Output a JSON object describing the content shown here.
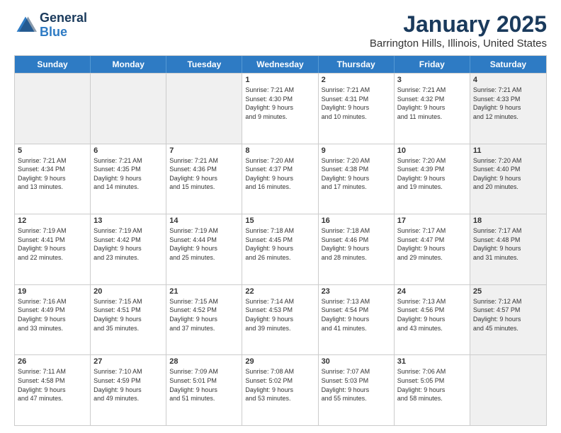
{
  "header": {
    "logo_line1": "General",
    "logo_line2": "Blue",
    "title": "January 2025",
    "subtitle": "Barrington Hills, Illinois, United States"
  },
  "days_of_week": [
    "Sunday",
    "Monday",
    "Tuesday",
    "Wednesday",
    "Thursday",
    "Friday",
    "Saturday"
  ],
  "weeks": [
    [
      {
        "day": "",
        "info": "",
        "shaded": true
      },
      {
        "day": "",
        "info": "",
        "shaded": true
      },
      {
        "day": "",
        "info": "",
        "shaded": true
      },
      {
        "day": "1",
        "info": "Sunrise: 7:21 AM\nSunset: 4:30 PM\nDaylight: 9 hours\nand 9 minutes.",
        "shaded": false
      },
      {
        "day": "2",
        "info": "Sunrise: 7:21 AM\nSunset: 4:31 PM\nDaylight: 9 hours\nand 10 minutes.",
        "shaded": false
      },
      {
        "day": "3",
        "info": "Sunrise: 7:21 AM\nSunset: 4:32 PM\nDaylight: 9 hours\nand 11 minutes.",
        "shaded": false
      },
      {
        "day": "4",
        "info": "Sunrise: 7:21 AM\nSunset: 4:33 PM\nDaylight: 9 hours\nand 12 minutes.",
        "shaded": true
      }
    ],
    [
      {
        "day": "5",
        "info": "Sunrise: 7:21 AM\nSunset: 4:34 PM\nDaylight: 9 hours\nand 13 minutes.",
        "shaded": false
      },
      {
        "day": "6",
        "info": "Sunrise: 7:21 AM\nSunset: 4:35 PM\nDaylight: 9 hours\nand 14 minutes.",
        "shaded": false
      },
      {
        "day": "7",
        "info": "Sunrise: 7:21 AM\nSunset: 4:36 PM\nDaylight: 9 hours\nand 15 minutes.",
        "shaded": false
      },
      {
        "day": "8",
        "info": "Sunrise: 7:20 AM\nSunset: 4:37 PM\nDaylight: 9 hours\nand 16 minutes.",
        "shaded": false
      },
      {
        "day": "9",
        "info": "Sunrise: 7:20 AM\nSunset: 4:38 PM\nDaylight: 9 hours\nand 17 minutes.",
        "shaded": false
      },
      {
        "day": "10",
        "info": "Sunrise: 7:20 AM\nSunset: 4:39 PM\nDaylight: 9 hours\nand 19 minutes.",
        "shaded": false
      },
      {
        "day": "11",
        "info": "Sunrise: 7:20 AM\nSunset: 4:40 PM\nDaylight: 9 hours\nand 20 minutes.",
        "shaded": true
      }
    ],
    [
      {
        "day": "12",
        "info": "Sunrise: 7:19 AM\nSunset: 4:41 PM\nDaylight: 9 hours\nand 22 minutes.",
        "shaded": false
      },
      {
        "day": "13",
        "info": "Sunrise: 7:19 AM\nSunset: 4:42 PM\nDaylight: 9 hours\nand 23 minutes.",
        "shaded": false
      },
      {
        "day": "14",
        "info": "Sunrise: 7:19 AM\nSunset: 4:44 PM\nDaylight: 9 hours\nand 25 minutes.",
        "shaded": false
      },
      {
        "day": "15",
        "info": "Sunrise: 7:18 AM\nSunset: 4:45 PM\nDaylight: 9 hours\nand 26 minutes.",
        "shaded": false
      },
      {
        "day": "16",
        "info": "Sunrise: 7:18 AM\nSunset: 4:46 PM\nDaylight: 9 hours\nand 28 minutes.",
        "shaded": false
      },
      {
        "day": "17",
        "info": "Sunrise: 7:17 AM\nSunset: 4:47 PM\nDaylight: 9 hours\nand 29 minutes.",
        "shaded": false
      },
      {
        "day": "18",
        "info": "Sunrise: 7:17 AM\nSunset: 4:48 PM\nDaylight: 9 hours\nand 31 minutes.",
        "shaded": true
      }
    ],
    [
      {
        "day": "19",
        "info": "Sunrise: 7:16 AM\nSunset: 4:49 PM\nDaylight: 9 hours\nand 33 minutes.",
        "shaded": false
      },
      {
        "day": "20",
        "info": "Sunrise: 7:15 AM\nSunset: 4:51 PM\nDaylight: 9 hours\nand 35 minutes.",
        "shaded": false
      },
      {
        "day": "21",
        "info": "Sunrise: 7:15 AM\nSunset: 4:52 PM\nDaylight: 9 hours\nand 37 minutes.",
        "shaded": false
      },
      {
        "day": "22",
        "info": "Sunrise: 7:14 AM\nSunset: 4:53 PM\nDaylight: 9 hours\nand 39 minutes.",
        "shaded": false
      },
      {
        "day": "23",
        "info": "Sunrise: 7:13 AM\nSunset: 4:54 PM\nDaylight: 9 hours\nand 41 minutes.",
        "shaded": false
      },
      {
        "day": "24",
        "info": "Sunrise: 7:13 AM\nSunset: 4:56 PM\nDaylight: 9 hours\nand 43 minutes.",
        "shaded": false
      },
      {
        "day": "25",
        "info": "Sunrise: 7:12 AM\nSunset: 4:57 PM\nDaylight: 9 hours\nand 45 minutes.",
        "shaded": true
      }
    ],
    [
      {
        "day": "26",
        "info": "Sunrise: 7:11 AM\nSunset: 4:58 PM\nDaylight: 9 hours\nand 47 minutes.",
        "shaded": false
      },
      {
        "day": "27",
        "info": "Sunrise: 7:10 AM\nSunset: 4:59 PM\nDaylight: 9 hours\nand 49 minutes.",
        "shaded": false
      },
      {
        "day": "28",
        "info": "Sunrise: 7:09 AM\nSunset: 5:01 PM\nDaylight: 9 hours\nand 51 minutes.",
        "shaded": false
      },
      {
        "day": "29",
        "info": "Sunrise: 7:08 AM\nSunset: 5:02 PM\nDaylight: 9 hours\nand 53 minutes.",
        "shaded": false
      },
      {
        "day": "30",
        "info": "Sunrise: 7:07 AM\nSunset: 5:03 PM\nDaylight: 9 hours\nand 55 minutes.",
        "shaded": false
      },
      {
        "day": "31",
        "info": "Sunrise: 7:06 AM\nSunset: 5:05 PM\nDaylight: 9 hours\nand 58 minutes.",
        "shaded": false
      },
      {
        "day": "",
        "info": "",
        "shaded": true
      }
    ]
  ]
}
